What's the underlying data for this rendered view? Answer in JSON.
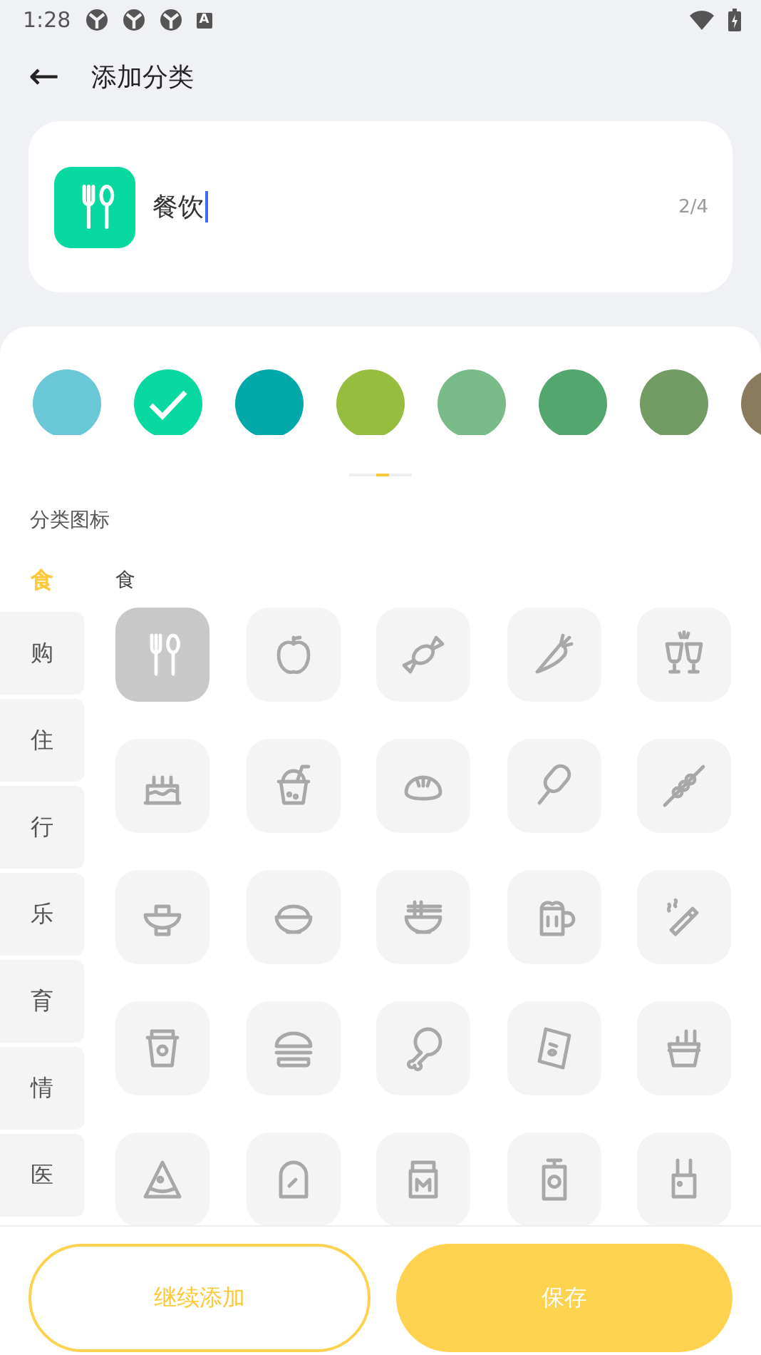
{
  "status_bar": {
    "time": "1:28",
    "notification_letter": "A"
  },
  "header": {
    "back_icon": "←",
    "title": "添加分类"
  },
  "name_card": {
    "value": "餐饮",
    "counter": "2/4"
  },
  "colors": [
    {
      "color": "#6ac8d6",
      "selected": false
    },
    {
      "color": "#08d9a0",
      "selected": true
    },
    {
      "color": "#00a8a8",
      "selected": false
    },
    {
      "color": "#97bd3e",
      "selected": false
    },
    {
      "color": "#78bb88",
      "selected": false
    },
    {
      "color": "#52a66e",
      "selected": false
    },
    {
      "color": "#739c65",
      "selected": false
    },
    {
      "color": "#8a7a5e",
      "selected": false
    }
  ],
  "section_label": "分类图标",
  "category_tabs": [
    {
      "label": "食",
      "selected": true
    },
    {
      "label": "购",
      "selected": false
    },
    {
      "label": "住",
      "selected": false
    },
    {
      "label": "行",
      "selected": false
    },
    {
      "label": "乐",
      "selected": false
    },
    {
      "label": "育",
      "selected": false
    },
    {
      "label": "情",
      "selected": false
    },
    {
      "label": "医",
      "selected": false
    }
  ],
  "group_title": "食",
  "icons": [
    {
      "selected": true
    },
    {
      "selected": false
    },
    {
      "selected": false
    },
    {
      "selected": false
    },
    {
      "selected": false
    },
    {
      "selected": false
    },
    {
      "selected": false
    },
    {
      "selected": false
    },
    {
      "selected": false
    },
    {
      "selected": false
    },
    {
      "selected": false
    },
    {
      "selected": false
    },
    {
      "selected": false
    },
    {
      "selected": false
    },
    {
      "selected": false
    },
    {
      "selected": false
    },
    {
      "selected": false
    },
    {
      "selected": false
    },
    {
      "selected": false
    },
    {
      "selected": false
    },
    {
      "selected": false
    },
    {
      "selected": false
    },
    {
      "selected": false
    },
    {
      "selected": false
    },
    {
      "selected": false
    }
  ],
  "buttons": [
    {
      "label": "继续添加",
      "kind": "outline"
    },
    {
      "label": "保存",
      "kind": "filled"
    }
  ]
}
